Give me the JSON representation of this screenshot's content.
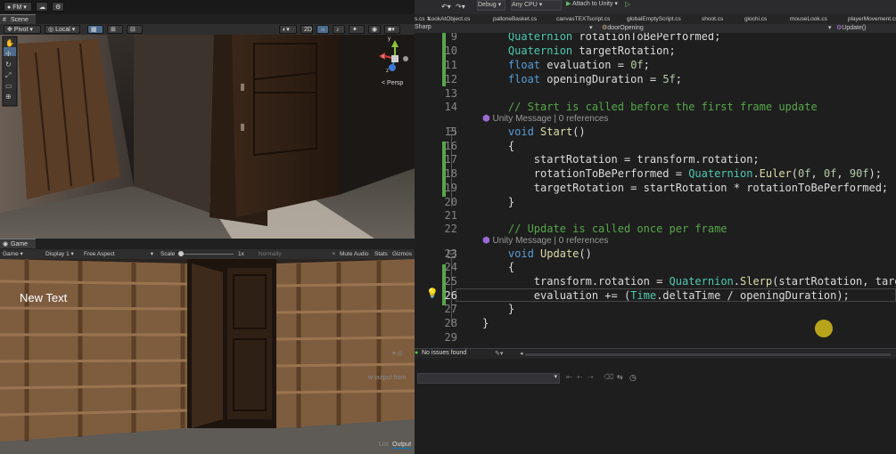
{
  "unity": {
    "account": "FM",
    "scene_tab": "Scene",
    "scene_toolbar": {
      "pivot": "Pivot",
      "local": "Local",
      "mode_2d": "2D",
      "persp": "< Persp",
      "gizmo_axes": [
        "y",
        "x",
        "z"
      ]
    },
    "game_tab": "Game",
    "game_toolbar": {
      "game_select": "Game",
      "display": "Display 1",
      "aspect": "Free Aspect",
      "scale_label": "Scale",
      "scale_value": "1x",
      "normally": "Normally",
      "mute": "Mute Audio",
      "stats": "Stats",
      "gizmos": "Gizmos"
    },
    "game_overlay_text": "New Text"
  },
  "vs": {
    "config": "Debug",
    "platform": "Any CPU",
    "attach": "Attach to Unity",
    "tabs": [
      "LookAtObject.cs",
      "palloneBasket.cs",
      "canvasTEXTscript.cs",
      "globalEmptyScript.cs",
      "shoot.cs",
      "giochi.cs",
      "mouseLook.cs",
      "playerMovement.cs"
    ],
    "nav": {
      "project": "Sharp",
      "class": "doorOpening",
      "member": "Update()"
    },
    "current_line": 26,
    "lines": [
      {
        "n": "9",
        "text": "    Quaternion rotationToBePerformed;"
      },
      {
        "n": "10",
        "text": "    Quaternion targetRotation;"
      },
      {
        "n": "11",
        "text": "    float evaluation = 0f;"
      },
      {
        "n": "12",
        "text": "    float openingDuration = 5f;"
      },
      {
        "n": "13",
        "text": ""
      },
      {
        "n": "14",
        "text": "    // Start is called before the first frame update"
      },
      {
        "n": "",
        "text": "Unity Message | 0 references"
      },
      {
        "n": "15",
        "text": "    void Start()"
      },
      {
        "n": "16",
        "text": "    {"
      },
      {
        "n": "17",
        "text": "        startRotation = transform.rotation;"
      },
      {
        "n": "18",
        "text": "        rotationToBePerformed = Quaternion.Euler(0f, 0f, 90f);"
      },
      {
        "n": "19",
        "text": "        targetRotation = startRotation * rotationToBePerformed;"
      },
      {
        "n": "20",
        "text": "    }"
      },
      {
        "n": "21",
        "text": ""
      },
      {
        "n": "22",
        "text": "    // Update is called once per frame"
      },
      {
        "n": "",
        "text": "Unity Message | 0 references"
      },
      {
        "n": "23",
        "text": "    void Update()"
      },
      {
        "n": "24",
        "text": "    {"
      },
      {
        "n": "25",
        "text": "        transform.rotation = Quaternion.Slerp(startRotation, targetRot"
      },
      {
        "n": "26",
        "text": "        evaluation += (Time.deltaTime / openingDuration);"
      },
      {
        "n": "27",
        "text": "    }"
      },
      {
        "n": "28",
        "text": "}"
      },
      {
        "n": "29",
        "text": ""
      }
    ],
    "status": "No issues found",
    "output": {
      "show_output_from": "w output from",
      "tabs": [
        "List",
        "Output"
      ]
    }
  }
}
